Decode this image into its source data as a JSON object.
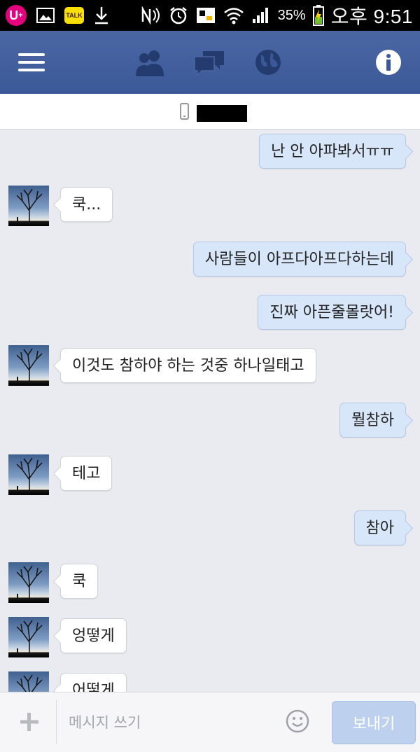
{
  "status_bar": {
    "carrier_icon": "lg-u-plus-icon",
    "talk_label": "TALK",
    "battery_percent": "35%",
    "time": "오후 9:51"
  },
  "top_nav": {
    "icons": [
      "menu-icon",
      "friends-icon",
      "messages-icon",
      "notifications-globe-icon",
      "info-icon"
    ],
    "active_color": "#3b5998"
  },
  "messages": [
    {
      "side": "sent",
      "text": "난 안 아파봐서ㅠㅠ"
    },
    {
      "side": "recv",
      "text": "쿡..."
    },
    {
      "side": "sent",
      "text": "사람들이 아프다아프다하는데"
    },
    {
      "side": "sent",
      "text": "진짜 아픈줄몰랏어!"
    },
    {
      "side": "recv",
      "text": "이것도 참하야 하는 것중 하나일태고"
    },
    {
      "side": "sent",
      "text": "뭘참하"
    },
    {
      "side": "recv",
      "text": "테고"
    },
    {
      "side": "sent",
      "text": "참아"
    },
    {
      "side": "recv",
      "text": "쿡"
    },
    {
      "side": "recv",
      "text": "엉떻게"
    },
    {
      "side": "recv",
      "text": "어떻게"
    }
  ],
  "composer": {
    "placeholder": "메시지 쓰기",
    "send_label": "보내기"
  }
}
